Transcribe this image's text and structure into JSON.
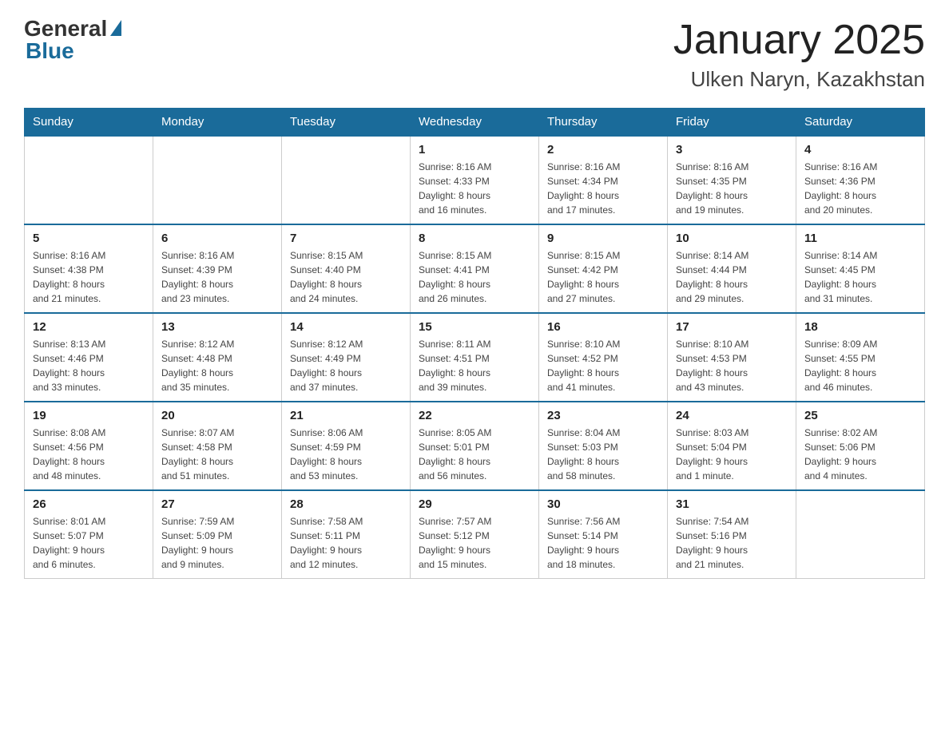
{
  "header": {
    "logo": {
      "general": "General",
      "blue": "Blue"
    },
    "title": "January 2025",
    "location": "Ulken Naryn, Kazakhstan"
  },
  "days_of_week": [
    "Sunday",
    "Monday",
    "Tuesday",
    "Wednesday",
    "Thursday",
    "Friday",
    "Saturday"
  ],
  "weeks": [
    [
      {
        "day": "",
        "info": ""
      },
      {
        "day": "",
        "info": ""
      },
      {
        "day": "",
        "info": ""
      },
      {
        "day": "1",
        "info": "Sunrise: 8:16 AM\nSunset: 4:33 PM\nDaylight: 8 hours\nand 16 minutes."
      },
      {
        "day": "2",
        "info": "Sunrise: 8:16 AM\nSunset: 4:34 PM\nDaylight: 8 hours\nand 17 minutes."
      },
      {
        "day": "3",
        "info": "Sunrise: 8:16 AM\nSunset: 4:35 PM\nDaylight: 8 hours\nand 19 minutes."
      },
      {
        "day": "4",
        "info": "Sunrise: 8:16 AM\nSunset: 4:36 PM\nDaylight: 8 hours\nand 20 minutes."
      }
    ],
    [
      {
        "day": "5",
        "info": "Sunrise: 8:16 AM\nSunset: 4:38 PM\nDaylight: 8 hours\nand 21 minutes."
      },
      {
        "day": "6",
        "info": "Sunrise: 8:16 AM\nSunset: 4:39 PM\nDaylight: 8 hours\nand 23 minutes."
      },
      {
        "day": "7",
        "info": "Sunrise: 8:15 AM\nSunset: 4:40 PM\nDaylight: 8 hours\nand 24 minutes."
      },
      {
        "day": "8",
        "info": "Sunrise: 8:15 AM\nSunset: 4:41 PM\nDaylight: 8 hours\nand 26 minutes."
      },
      {
        "day": "9",
        "info": "Sunrise: 8:15 AM\nSunset: 4:42 PM\nDaylight: 8 hours\nand 27 minutes."
      },
      {
        "day": "10",
        "info": "Sunrise: 8:14 AM\nSunset: 4:44 PM\nDaylight: 8 hours\nand 29 minutes."
      },
      {
        "day": "11",
        "info": "Sunrise: 8:14 AM\nSunset: 4:45 PM\nDaylight: 8 hours\nand 31 minutes."
      }
    ],
    [
      {
        "day": "12",
        "info": "Sunrise: 8:13 AM\nSunset: 4:46 PM\nDaylight: 8 hours\nand 33 minutes."
      },
      {
        "day": "13",
        "info": "Sunrise: 8:12 AM\nSunset: 4:48 PM\nDaylight: 8 hours\nand 35 minutes."
      },
      {
        "day": "14",
        "info": "Sunrise: 8:12 AM\nSunset: 4:49 PM\nDaylight: 8 hours\nand 37 minutes."
      },
      {
        "day": "15",
        "info": "Sunrise: 8:11 AM\nSunset: 4:51 PM\nDaylight: 8 hours\nand 39 minutes."
      },
      {
        "day": "16",
        "info": "Sunrise: 8:10 AM\nSunset: 4:52 PM\nDaylight: 8 hours\nand 41 minutes."
      },
      {
        "day": "17",
        "info": "Sunrise: 8:10 AM\nSunset: 4:53 PM\nDaylight: 8 hours\nand 43 minutes."
      },
      {
        "day": "18",
        "info": "Sunrise: 8:09 AM\nSunset: 4:55 PM\nDaylight: 8 hours\nand 46 minutes."
      }
    ],
    [
      {
        "day": "19",
        "info": "Sunrise: 8:08 AM\nSunset: 4:56 PM\nDaylight: 8 hours\nand 48 minutes."
      },
      {
        "day": "20",
        "info": "Sunrise: 8:07 AM\nSunset: 4:58 PM\nDaylight: 8 hours\nand 51 minutes."
      },
      {
        "day": "21",
        "info": "Sunrise: 8:06 AM\nSunset: 4:59 PM\nDaylight: 8 hours\nand 53 minutes."
      },
      {
        "day": "22",
        "info": "Sunrise: 8:05 AM\nSunset: 5:01 PM\nDaylight: 8 hours\nand 56 minutes."
      },
      {
        "day": "23",
        "info": "Sunrise: 8:04 AM\nSunset: 5:03 PM\nDaylight: 8 hours\nand 58 minutes."
      },
      {
        "day": "24",
        "info": "Sunrise: 8:03 AM\nSunset: 5:04 PM\nDaylight: 9 hours\nand 1 minute."
      },
      {
        "day": "25",
        "info": "Sunrise: 8:02 AM\nSunset: 5:06 PM\nDaylight: 9 hours\nand 4 minutes."
      }
    ],
    [
      {
        "day": "26",
        "info": "Sunrise: 8:01 AM\nSunset: 5:07 PM\nDaylight: 9 hours\nand 6 minutes."
      },
      {
        "day": "27",
        "info": "Sunrise: 7:59 AM\nSunset: 5:09 PM\nDaylight: 9 hours\nand 9 minutes."
      },
      {
        "day": "28",
        "info": "Sunrise: 7:58 AM\nSunset: 5:11 PM\nDaylight: 9 hours\nand 12 minutes."
      },
      {
        "day": "29",
        "info": "Sunrise: 7:57 AM\nSunset: 5:12 PM\nDaylight: 9 hours\nand 15 minutes."
      },
      {
        "day": "30",
        "info": "Sunrise: 7:56 AM\nSunset: 5:14 PM\nDaylight: 9 hours\nand 18 minutes."
      },
      {
        "day": "31",
        "info": "Sunrise: 7:54 AM\nSunset: 5:16 PM\nDaylight: 9 hours\nand 21 minutes."
      },
      {
        "day": "",
        "info": ""
      }
    ]
  ]
}
